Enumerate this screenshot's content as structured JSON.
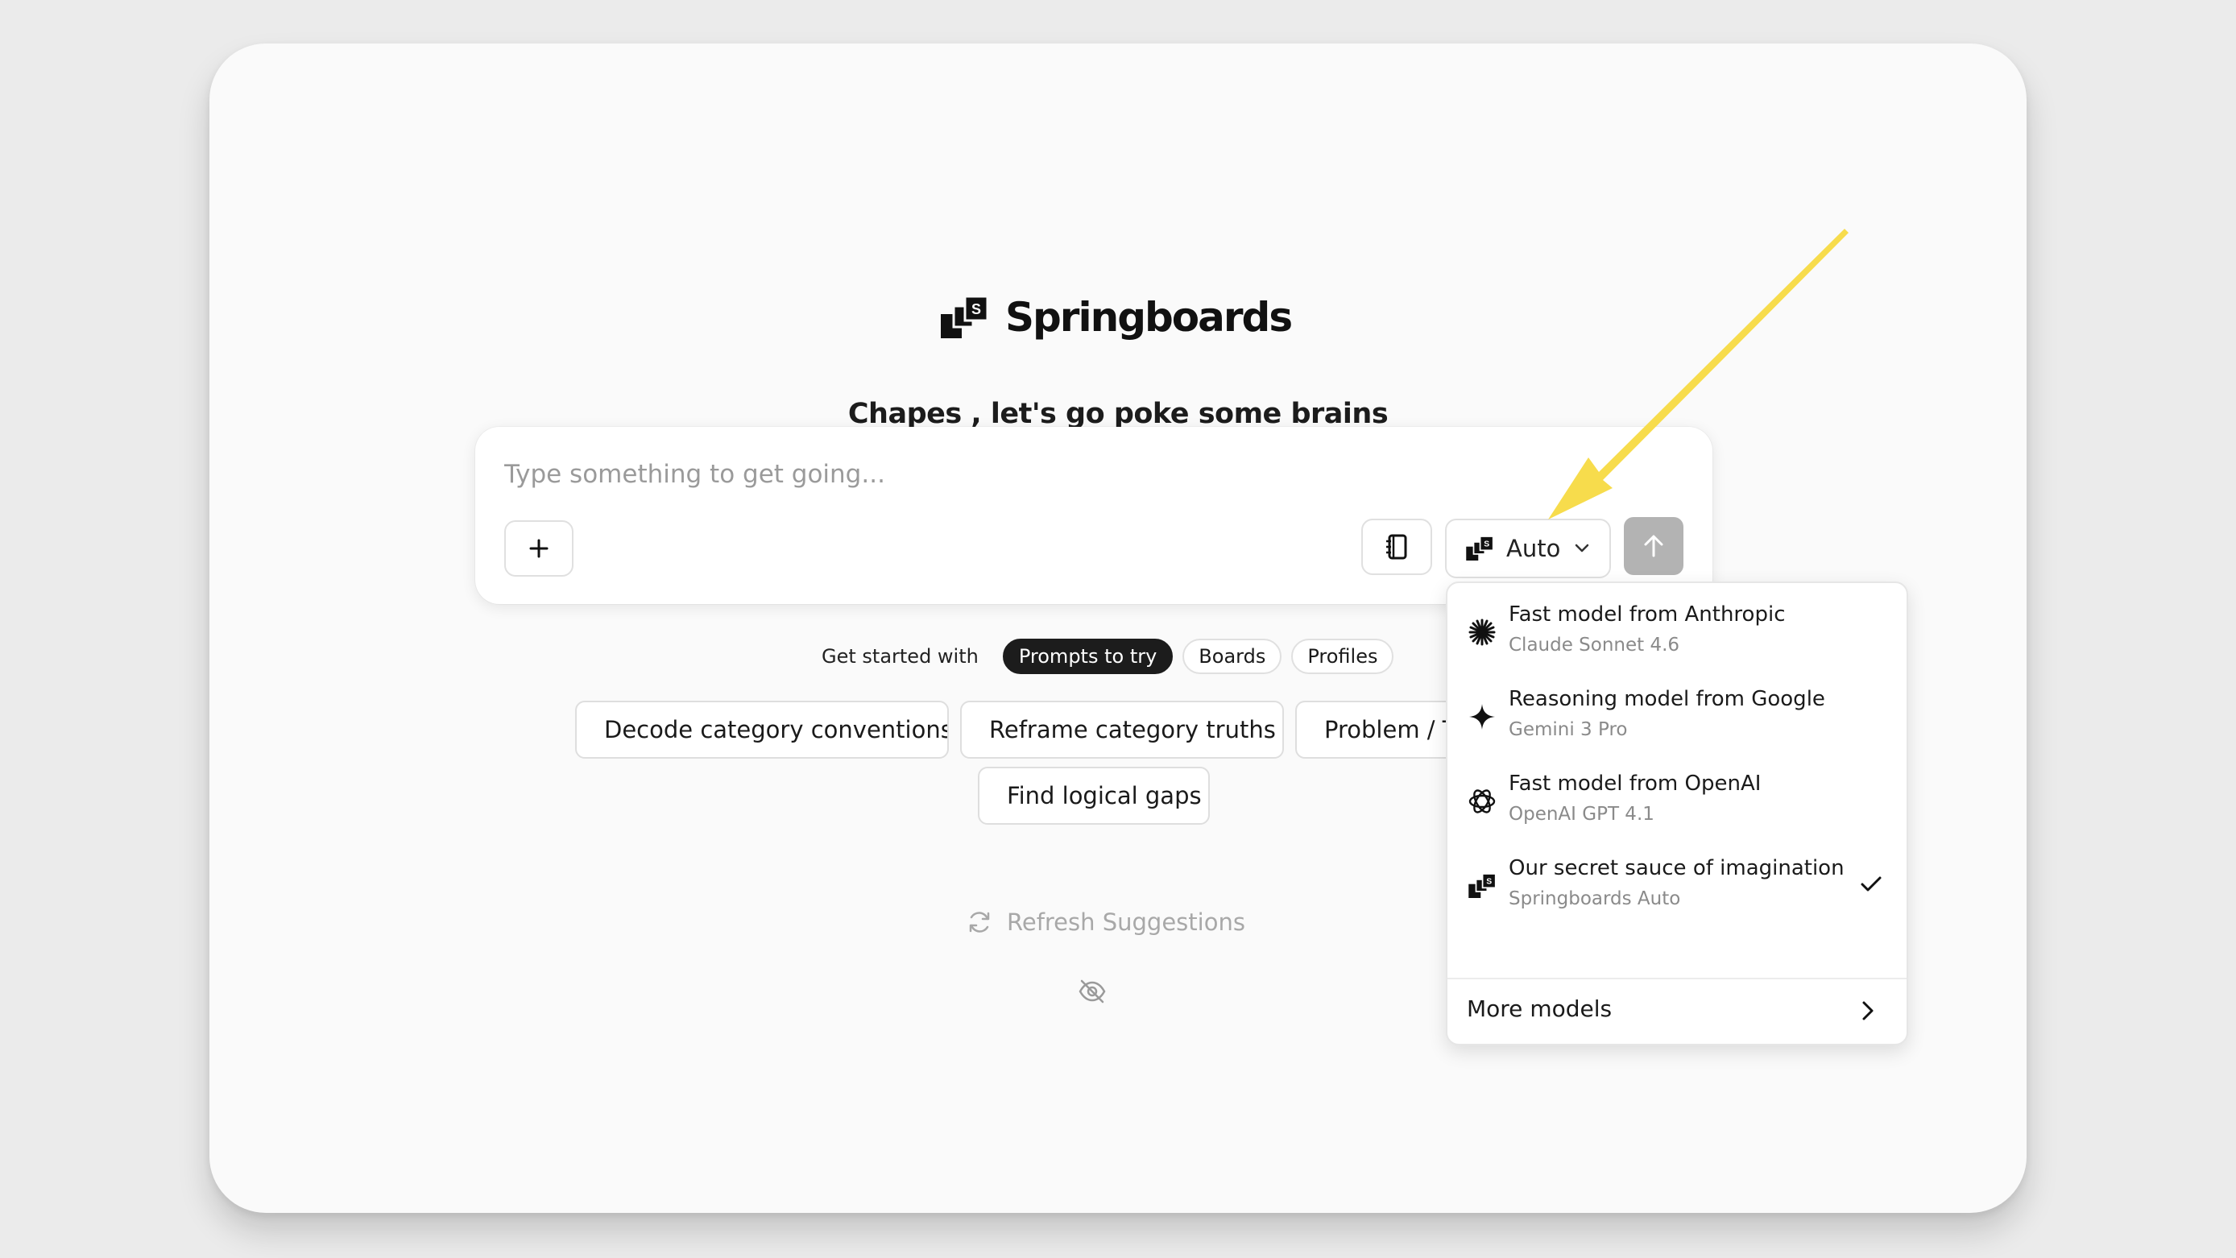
{
  "app": {
    "brand": "Springboards",
    "greeting": "Chapes , let's go poke some brains"
  },
  "composer": {
    "placeholder": "Type something to get going...",
    "value": "",
    "model_label": "Auto",
    "icons": {
      "add": "plus-icon",
      "notebook": "notebook-icon",
      "model": "springboards-logo-icon",
      "chevron": "chevron-down-icon",
      "send": "arrow-up-icon"
    }
  },
  "get_started": {
    "label": "Get started with",
    "tabs": [
      {
        "label": "Prompts to try",
        "active": true
      },
      {
        "label": "Boards",
        "active": false
      },
      {
        "label": "Profiles",
        "active": false
      }
    ]
  },
  "suggestions": [
    "Decode category conventions",
    "Reframe category truths",
    "Problem / Tru",
    "Find logical gaps"
  ],
  "refresh_label": "Refresh Suggestions",
  "model_menu": {
    "items": [
      {
        "title": "Fast model from Anthropic",
        "subtitle": "Claude Sonnet 4.6",
        "icon": "anthropic-asterisk-icon",
        "selected": false
      },
      {
        "title": "Reasoning model from Google",
        "subtitle": "Gemini 3 Pro",
        "icon": "gemini-sparkle-icon",
        "selected": false
      },
      {
        "title": "Fast model from OpenAI",
        "subtitle": "OpenAI GPT 4.1",
        "icon": "openai-knot-icon",
        "selected": false
      },
      {
        "title": "Our secret sauce of imagination",
        "subtitle": "Springboards Auto",
        "icon": "springboards-logo-icon",
        "selected": true
      }
    ],
    "more_label": "More models"
  },
  "colors": {
    "background": "#ebebeb",
    "window": "#fafafa",
    "annotation_arrow": "#f7dc4c",
    "send_button": "#b3b3b3"
  }
}
